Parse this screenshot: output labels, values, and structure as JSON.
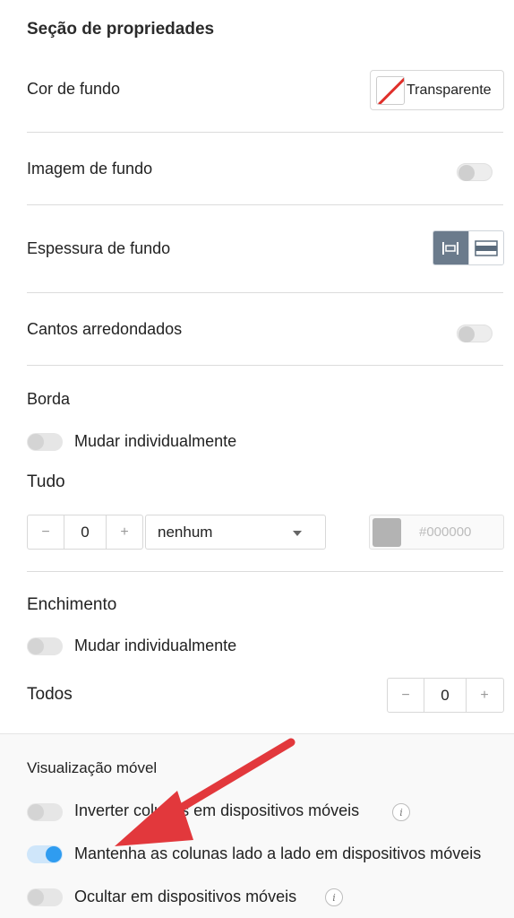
{
  "section_title": "Seção de propriedades",
  "background_color": {
    "label": "Cor de fundo",
    "button_label": "Transparente"
  },
  "background_image": {
    "label": "Imagem de fundo",
    "enabled": false
  },
  "background_thickness": {
    "label": "Espessura de fundo",
    "options": [
      "fixed-width-icon",
      "full-width-icon"
    ],
    "selected": 0
  },
  "rounded_corners": {
    "label": "Cantos arredondados",
    "enabled": false
  },
  "border": {
    "label": "Borda",
    "individual_label": "Mudar individualmente",
    "individual_enabled": false,
    "all_label": "Tudo",
    "width_value": "0",
    "minus": "−",
    "plus": "+",
    "style_value": "nenhum",
    "color_placeholder": "#000000",
    "color_swatch": "#b3b3b3"
  },
  "padding": {
    "label": "Enchimento",
    "individual_label": "Mudar individualmente",
    "individual_enabled": false,
    "all_label": "Todos",
    "value": "0",
    "minus": "−",
    "plus": "+"
  },
  "mobile": {
    "label": "Visualização móvel",
    "items": [
      {
        "label": "Inverter colunas em dispositivos móveis",
        "enabled": false,
        "info": "i"
      },
      {
        "label": "Mantenha as colunas lado a lado em dispositivos móveis",
        "enabled": true
      },
      {
        "label": "Ocultar em dispositivos móveis",
        "enabled": false,
        "info": "i"
      }
    ]
  },
  "colors": {
    "toggle_on": "#2f9cf0",
    "arrow": "#e2383c",
    "segment_active": "#6b7b8c"
  }
}
